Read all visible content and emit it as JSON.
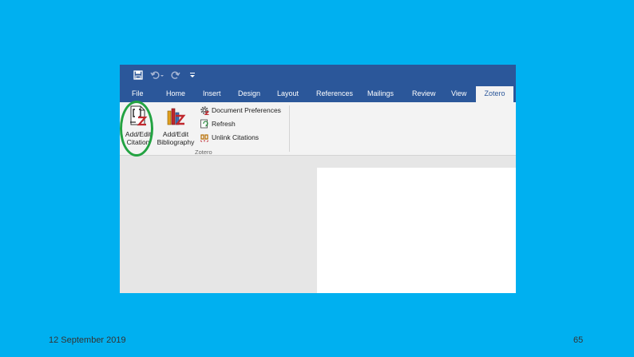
{
  "ribbon_tabs": [
    {
      "label": "File",
      "active": false
    },
    {
      "label": "Home",
      "active": false
    },
    {
      "label": "Insert",
      "active": false
    },
    {
      "label": "Design",
      "active": false
    },
    {
      "label": "Layout",
      "active": false
    },
    {
      "label": "References",
      "active": false
    },
    {
      "label": "Mailings",
      "active": false
    },
    {
      "label": "Review",
      "active": false
    },
    {
      "label": "View",
      "active": false
    },
    {
      "label": "Zotero",
      "active": true
    }
  ],
  "zotero_group": {
    "add_citation": {
      "line1": "Add/Edit",
      "line2": "Citation",
      "icon": "citation-icon"
    },
    "add_bibliography": {
      "line1": "Add/Edit",
      "line2": "Bibliography",
      "icon": "bibliography-icon"
    },
    "document_preferences": {
      "label": "Document Preferences",
      "icon": "gear-icon"
    },
    "refresh": {
      "label": "Refresh",
      "icon": "refresh-icon"
    },
    "unlink_citations": {
      "label": "Unlink Citations",
      "icon": "unlink-icon"
    },
    "group_label": "Zotero"
  },
  "quick_access": {
    "icons": [
      "save-icon",
      "undo-icon",
      "redo-icon",
      "customize-chevron-icon"
    ]
  },
  "slide_footer": {
    "date": "12 September 2019",
    "page_number": "65"
  },
  "colors": {
    "slide_background": "#00b0f0",
    "ribbon_blue": "#2b579a",
    "highlight_ring": "#23a342",
    "zotero_red": "#c0272d"
  }
}
